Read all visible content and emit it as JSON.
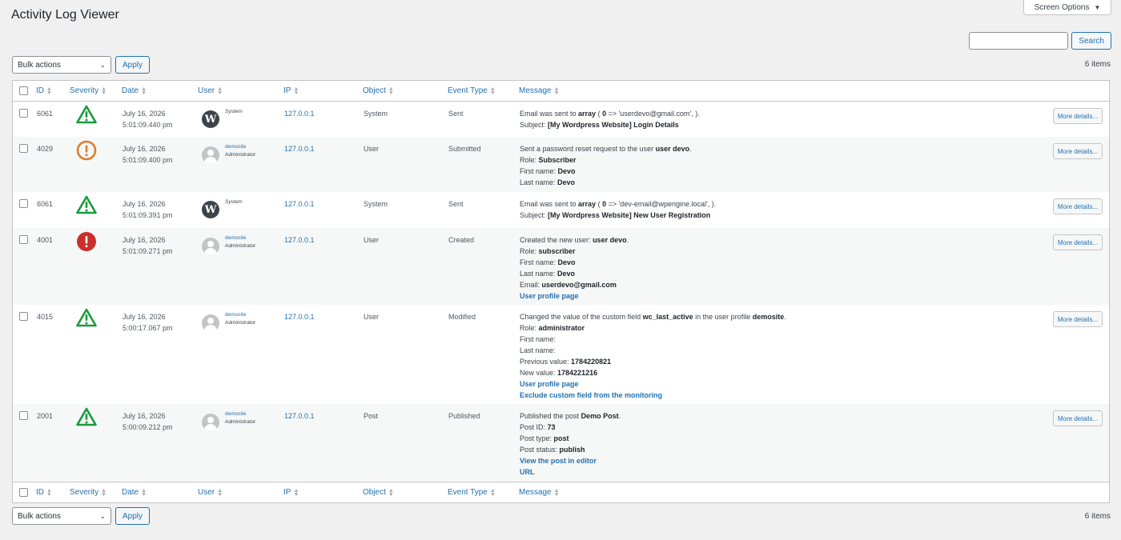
{
  "page": {
    "title": "Activity Log Viewer",
    "screen_options": "Screen Options",
    "search_button": "Search",
    "search_value": "",
    "bulk_actions": "Bulk actions",
    "apply": "Apply",
    "items_count": "6 items"
  },
  "columns": {
    "id": "ID",
    "severity": "Severity",
    "date": "Date",
    "user": "User",
    "ip": "IP",
    "object": "Object",
    "event_type": "Event Type",
    "message": "Message"
  },
  "details_label": "More details...",
  "colors": {
    "green": "#1a9b3c",
    "orange": "#e07b27",
    "red": "#c9302c",
    "link": "#2271b1"
  },
  "rows": [
    {
      "id": "6061",
      "severity": "warning-green-icon",
      "date": "July 16, 2026",
      "time": "5:01:09.440 pm",
      "user_type": "system",
      "user_name": "System",
      "user_role": "",
      "ip": "127.0.0.1",
      "object": "System",
      "event_type": "Sent",
      "message": [
        {
          "t": "Email was sent to ",
          "b": "array",
          "a": " ( ",
          "b2": "0",
          "a2": " => 'userdevo@gmail.com', )."
        },
        {
          "t": "Subject: ",
          "b": "[My Wordpress Website] Login Details"
        }
      ]
    },
    {
      "id": "4029",
      "severity": "alert-orange-icon",
      "date": "July 16, 2026",
      "time": "5:01:09.400 pm",
      "user_type": "user",
      "user_name": "demosite",
      "user_role": "Administrator",
      "ip": "127.0.0.1",
      "object": "User",
      "event_type": "Submitted",
      "message": [
        {
          "t": "Sent a password reset request to the user ",
          "b": "user devo",
          "a": "."
        },
        {
          "t": "Role: ",
          "b": "Subscriber"
        },
        {
          "t": "First name: ",
          "b": "Devo"
        },
        {
          "t": "Last name: ",
          "b": "Devo"
        }
      ]
    },
    {
      "id": "6061",
      "severity": "warning-green-icon",
      "date": "July 16, 2026",
      "time": "5:01:09.391 pm",
      "user_type": "system",
      "user_name": "System",
      "user_role": "",
      "ip": "127.0.0.1",
      "object": "System",
      "event_type": "Sent",
      "message": [
        {
          "t": "Email was sent to ",
          "b": "array",
          "a": " ( ",
          "b2": "0",
          "a2": " => 'dev-email@wpengine.local', )."
        },
        {
          "t": "Subject: ",
          "b": "[My Wordpress Website] New User Registration"
        }
      ]
    },
    {
      "id": "4001",
      "severity": "alert-red-icon",
      "date": "July 16, 2026",
      "time": "5:01:09.271 pm",
      "user_type": "user",
      "user_name": "demosite",
      "user_role": "Administrator",
      "ip": "127.0.0.1",
      "object": "User",
      "event_type": "Created",
      "message": [
        {
          "t": "Created the new user: ",
          "b": "user devo",
          "a": "."
        },
        {
          "t": "Role: ",
          "b": "subscriber"
        },
        {
          "t": "First name: ",
          "b": "Devo"
        },
        {
          "t": "Last name: ",
          "b": "Devo"
        },
        {
          "t": "Email: ",
          "b": "userdevo@gmail.com"
        },
        {
          "link": "User profile page"
        }
      ]
    },
    {
      "id": "4015",
      "severity": "warning-green-icon",
      "date": "July 16, 2026",
      "time": "5:00:17.067 pm",
      "user_type": "user",
      "user_name": "demosite",
      "user_role": "Administrator",
      "ip": "127.0.0.1",
      "object": "User",
      "event_type": "Modified",
      "message": [
        {
          "t": "Changed the value of the custom field ",
          "b": "wc_last_active",
          "a": " in the user profile ",
          "b2": "demosite",
          "a2": "."
        },
        {
          "t": "Role: ",
          "b": "administrator"
        },
        {
          "t": "First name:"
        },
        {
          "t": "Last name:"
        },
        {
          "t": "Previous value: ",
          "b": "1784220821"
        },
        {
          "t": "New value: ",
          "b": "1784221216"
        },
        {
          "link": "User profile page"
        },
        {
          "link": "Exclude custom field from the monitoring"
        }
      ]
    },
    {
      "id": "2001",
      "severity": "warning-green-icon",
      "date": "July 16, 2026",
      "time": "5:00:09.212 pm",
      "user_type": "user",
      "user_name": "demosite",
      "user_role": "Administrator",
      "ip": "127.0.0.1",
      "object": "Post",
      "event_type": "Published",
      "message": [
        {
          "t": "Published the post ",
          "b": "Demo Post",
          "a": "."
        },
        {
          "t": "Post ID: ",
          "b": "73"
        },
        {
          "t": "Post type: ",
          "b": "post"
        },
        {
          "t": "Post status: ",
          "b": "publish"
        },
        {
          "link": "View the post in editor"
        },
        {
          "link": "URL"
        }
      ]
    }
  ]
}
